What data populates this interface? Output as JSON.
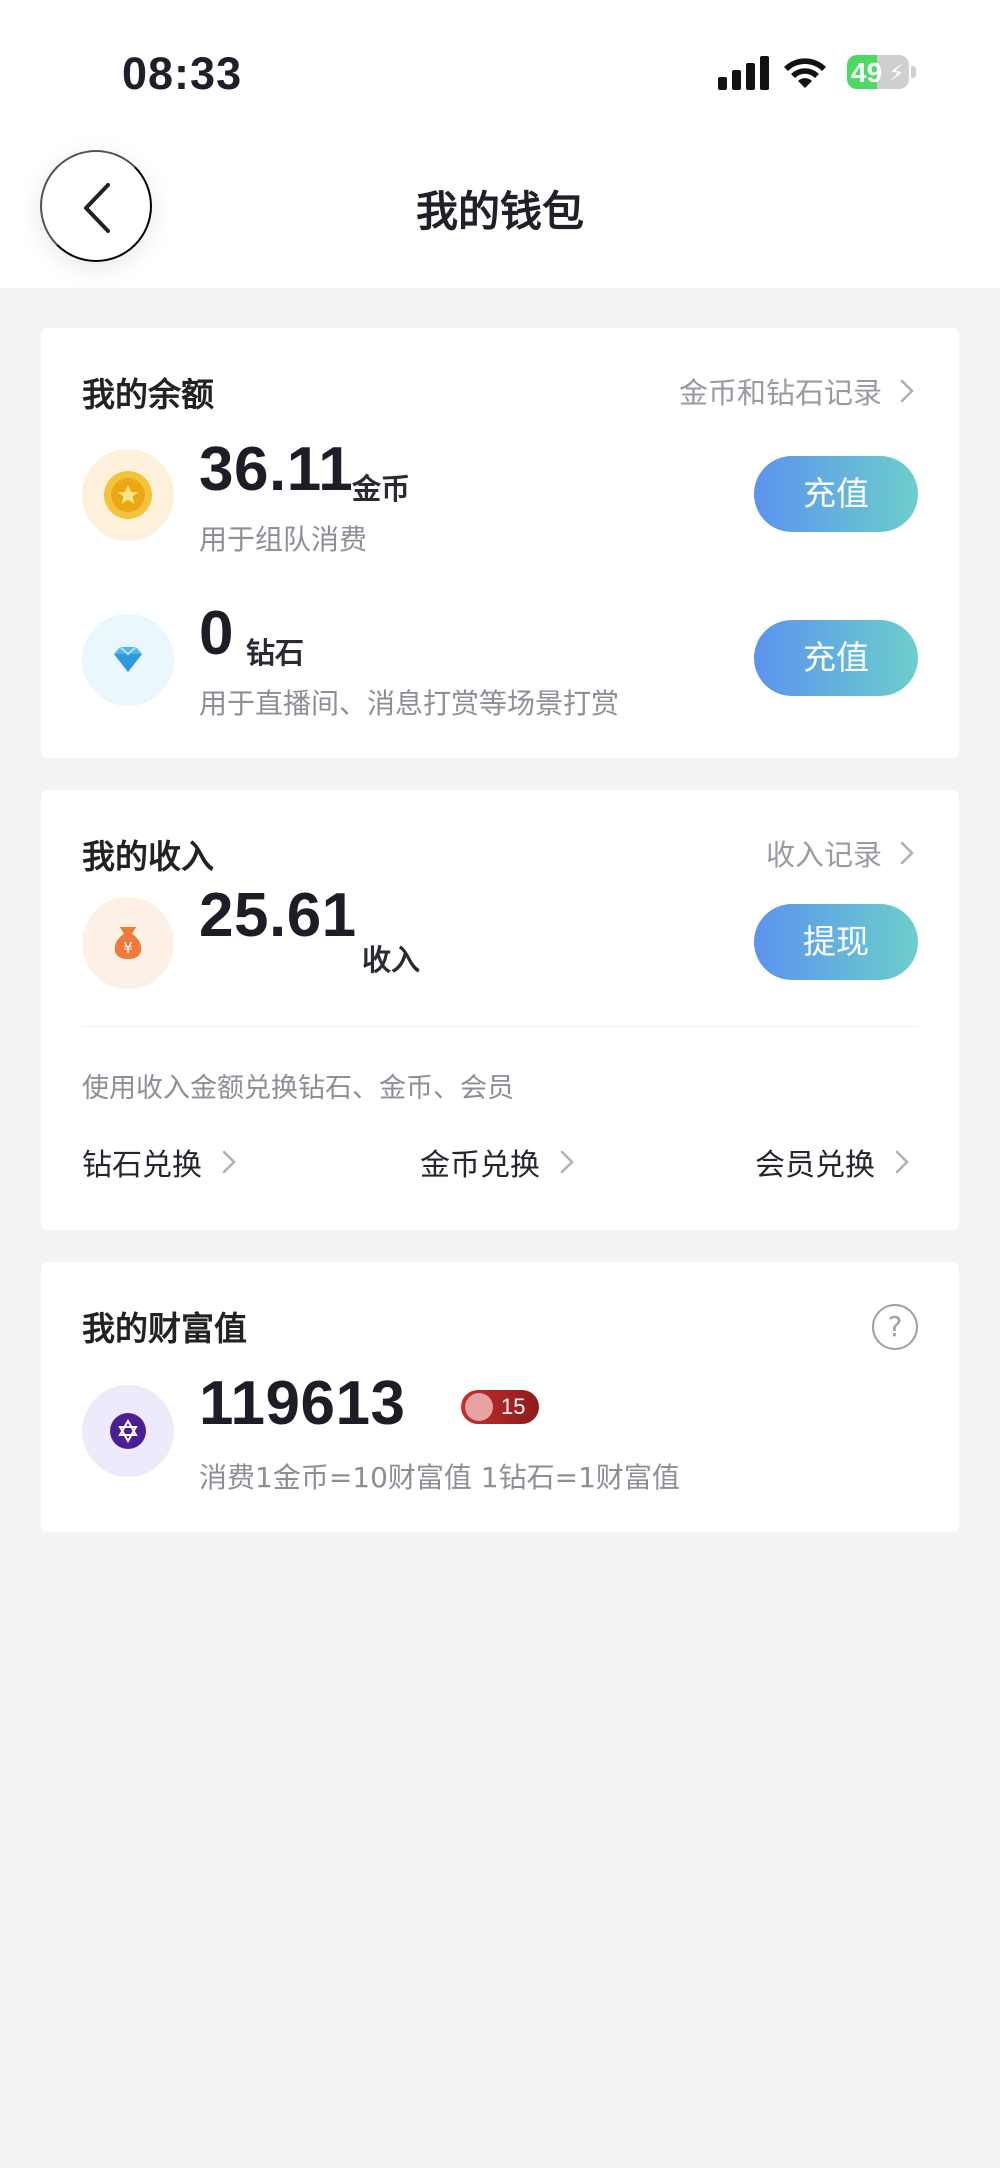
{
  "status": {
    "time": "08:33",
    "battery": "49",
    "battery_level": 0.49
  },
  "nav": {
    "title": "我的钱包"
  },
  "balance": {
    "title": "我的余额",
    "link_label": "金币和钻石记录",
    "coins": {
      "amount": "36.11",
      "unit": "金币",
      "desc": "用于组队消费",
      "button": "充值",
      "icon": "coin-icon"
    },
    "diamonds": {
      "amount": "0",
      "unit": "钻石",
      "desc": "用于直播间、消息打赏等场景打赏",
      "button": "充值",
      "icon": "diamond-icon"
    }
  },
  "income": {
    "title": "我的收入",
    "link_label": "收入记录",
    "amount": "25.61",
    "unit": "收入",
    "button": "提现",
    "icon": "money-bag-icon",
    "exchange_hint": "使用收入金额兑换钻石、金币、会员",
    "exchanges": [
      "钻石兑换",
      "金币兑换",
      "会员兑换"
    ]
  },
  "wealth": {
    "title": "我的财富值",
    "value": "119613",
    "level": "15",
    "icon": "star-of-david-icon",
    "desc": "消费1金币=10财富值 1钻石=1财富值"
  },
  "colors": {
    "button_gradient_start": "#5b93ee",
    "button_gradient_end": "#6ccfcb",
    "coin": "#f2b92d",
    "diamond": "#4fb6ef",
    "money_bag": "#f07a3c",
    "wealth": "#4a1f94",
    "badge": "#c2302f"
  }
}
